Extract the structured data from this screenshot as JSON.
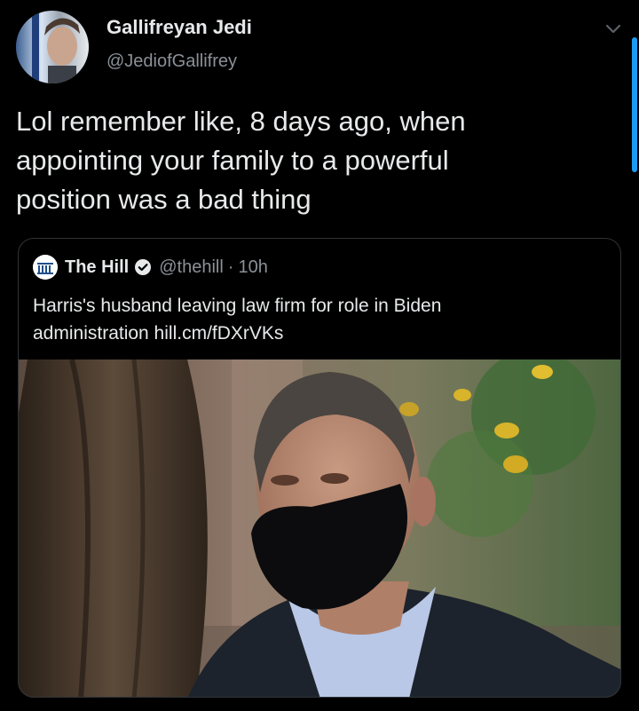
{
  "tweet": {
    "display_name": "Gallifreyan Jedi",
    "handle": "@JediofGallifrey",
    "text": "Lol remember like, 8 days ago, when\nappointing your family to a powerful\nposition was a bad thing",
    "avatar_icon": "profile-avatar"
  },
  "quoted_tweet": {
    "name": "The Hill",
    "verified_icon": "verified-badge-icon",
    "handle": "@thehill",
    "separator": "·",
    "time": "10h",
    "text": "Harris's husband leaving law firm for role in Biden\nadministration hill.cm/fDXrVKs",
    "image_icon": "news-photo"
  },
  "colors": {
    "background": "#000000",
    "text_primary": "#e7e9ea",
    "text_secondary": "#8b9198",
    "border": "#2f3336",
    "accent": "#1d9bf0"
  }
}
